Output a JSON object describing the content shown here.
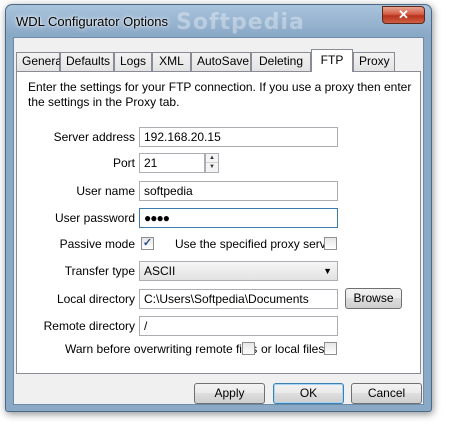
{
  "window": {
    "title": "WDL Configurator Options",
    "close_label": "✕",
    "watermark": "Softpedia"
  },
  "tabs": [
    {
      "label": "General"
    },
    {
      "label": "Defaults"
    },
    {
      "label": "Logs"
    },
    {
      "label": "XML"
    },
    {
      "label": "AutoSave"
    },
    {
      "label": "Deleting"
    },
    {
      "label": "FTP"
    },
    {
      "label": "Proxy"
    }
  ],
  "active_tab": "FTP",
  "ftp": {
    "intro": "Enter the settings for your FTP connection. If you use a proxy then enter the settings in the Proxy tab.",
    "server_address": {
      "label": "Server address",
      "value": "192.168.20.15"
    },
    "port": {
      "label": "Port",
      "value": "21"
    },
    "user_name": {
      "label": "User name",
      "value": "softpedia"
    },
    "user_password": {
      "label": "User password",
      "value": "●●●●"
    },
    "passive_mode": {
      "label": "Passive mode",
      "checked": true,
      "check_glyph": "✓"
    },
    "use_proxy": {
      "label": "Use the specified proxy server",
      "checked": false
    },
    "transfer_type": {
      "label": "Transfer type",
      "value": "ASCII",
      "arrow": "▼"
    },
    "local_directory": {
      "label": "Local directory",
      "value": "C:\\Users\\Softpedia\\Documents",
      "browse_label": "Browse"
    },
    "remote_directory": {
      "label": "Remote directory",
      "value": "/"
    },
    "warn_remote": {
      "label": "Warn before overwriting remote files",
      "checked": false
    },
    "warn_local": {
      "label": "or local files",
      "checked": false
    },
    "watermark": "SOFTPEDIA"
  },
  "buttons": {
    "apply": "Apply",
    "ok": "OK",
    "cancel": "Cancel"
  },
  "colors": {
    "accent": "#3d7bad",
    "title_bar": "#8aa9c7"
  }
}
